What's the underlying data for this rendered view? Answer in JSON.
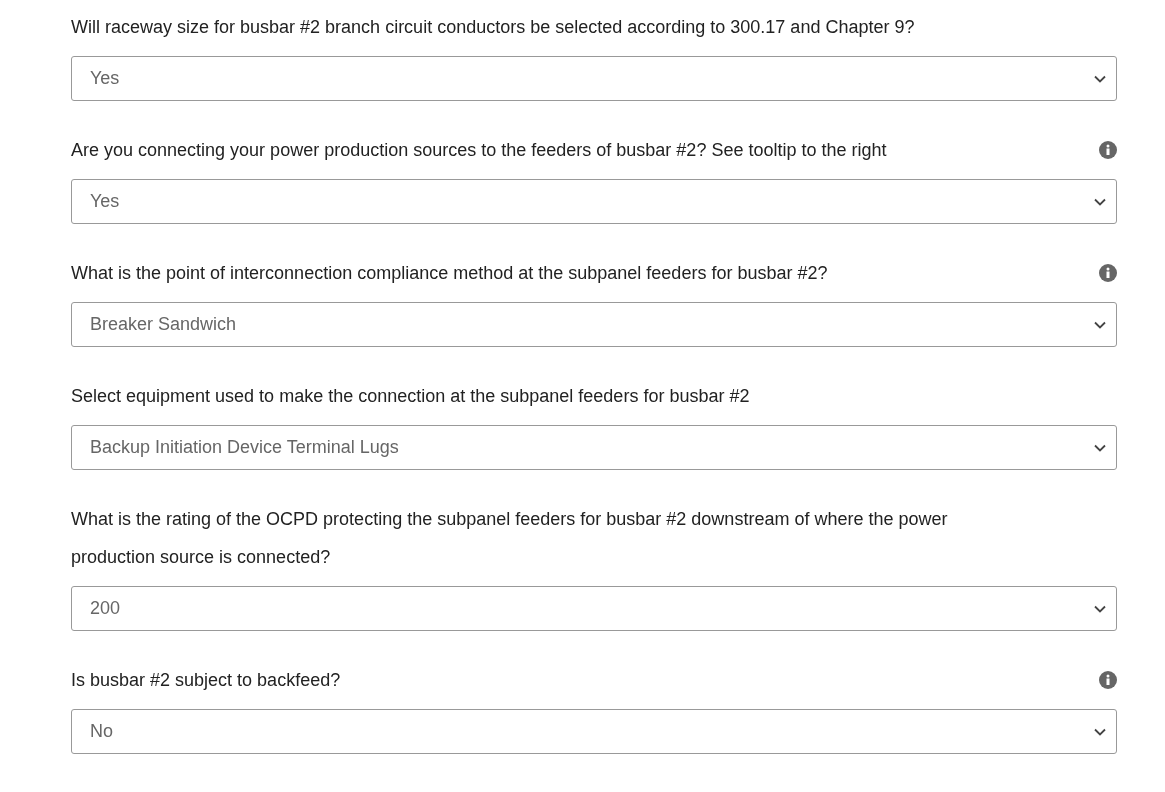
{
  "questions": [
    {
      "label": "Will raceway size for busbar #2 branch circuit conductors be selected according to 300.17 and Chapter 9?",
      "has_tooltip": false,
      "value": "Yes"
    },
    {
      "label": "Are you connecting your power production sources to the feeders of busbar #2? See tooltip to the right",
      "has_tooltip": true,
      "value": "Yes"
    },
    {
      "label": "What is the point of interconnection compliance method at the subpanel feeders for busbar #2?",
      "has_tooltip": true,
      "value": "Breaker Sandwich"
    },
    {
      "label": "Select equipment used to make the connection at the subpanel feeders for busbar #2",
      "has_tooltip": false,
      "value": "Backup Initiation Device Terminal Lugs"
    },
    {
      "label": "What is the rating of the OCPD protecting the subpanel feeders for busbar #2 downstream of where the power production source is connected?",
      "has_tooltip": false,
      "value": "200"
    },
    {
      "label": "Is busbar #2 subject to backfeed?",
      "has_tooltip": true,
      "value": "No"
    }
  ]
}
